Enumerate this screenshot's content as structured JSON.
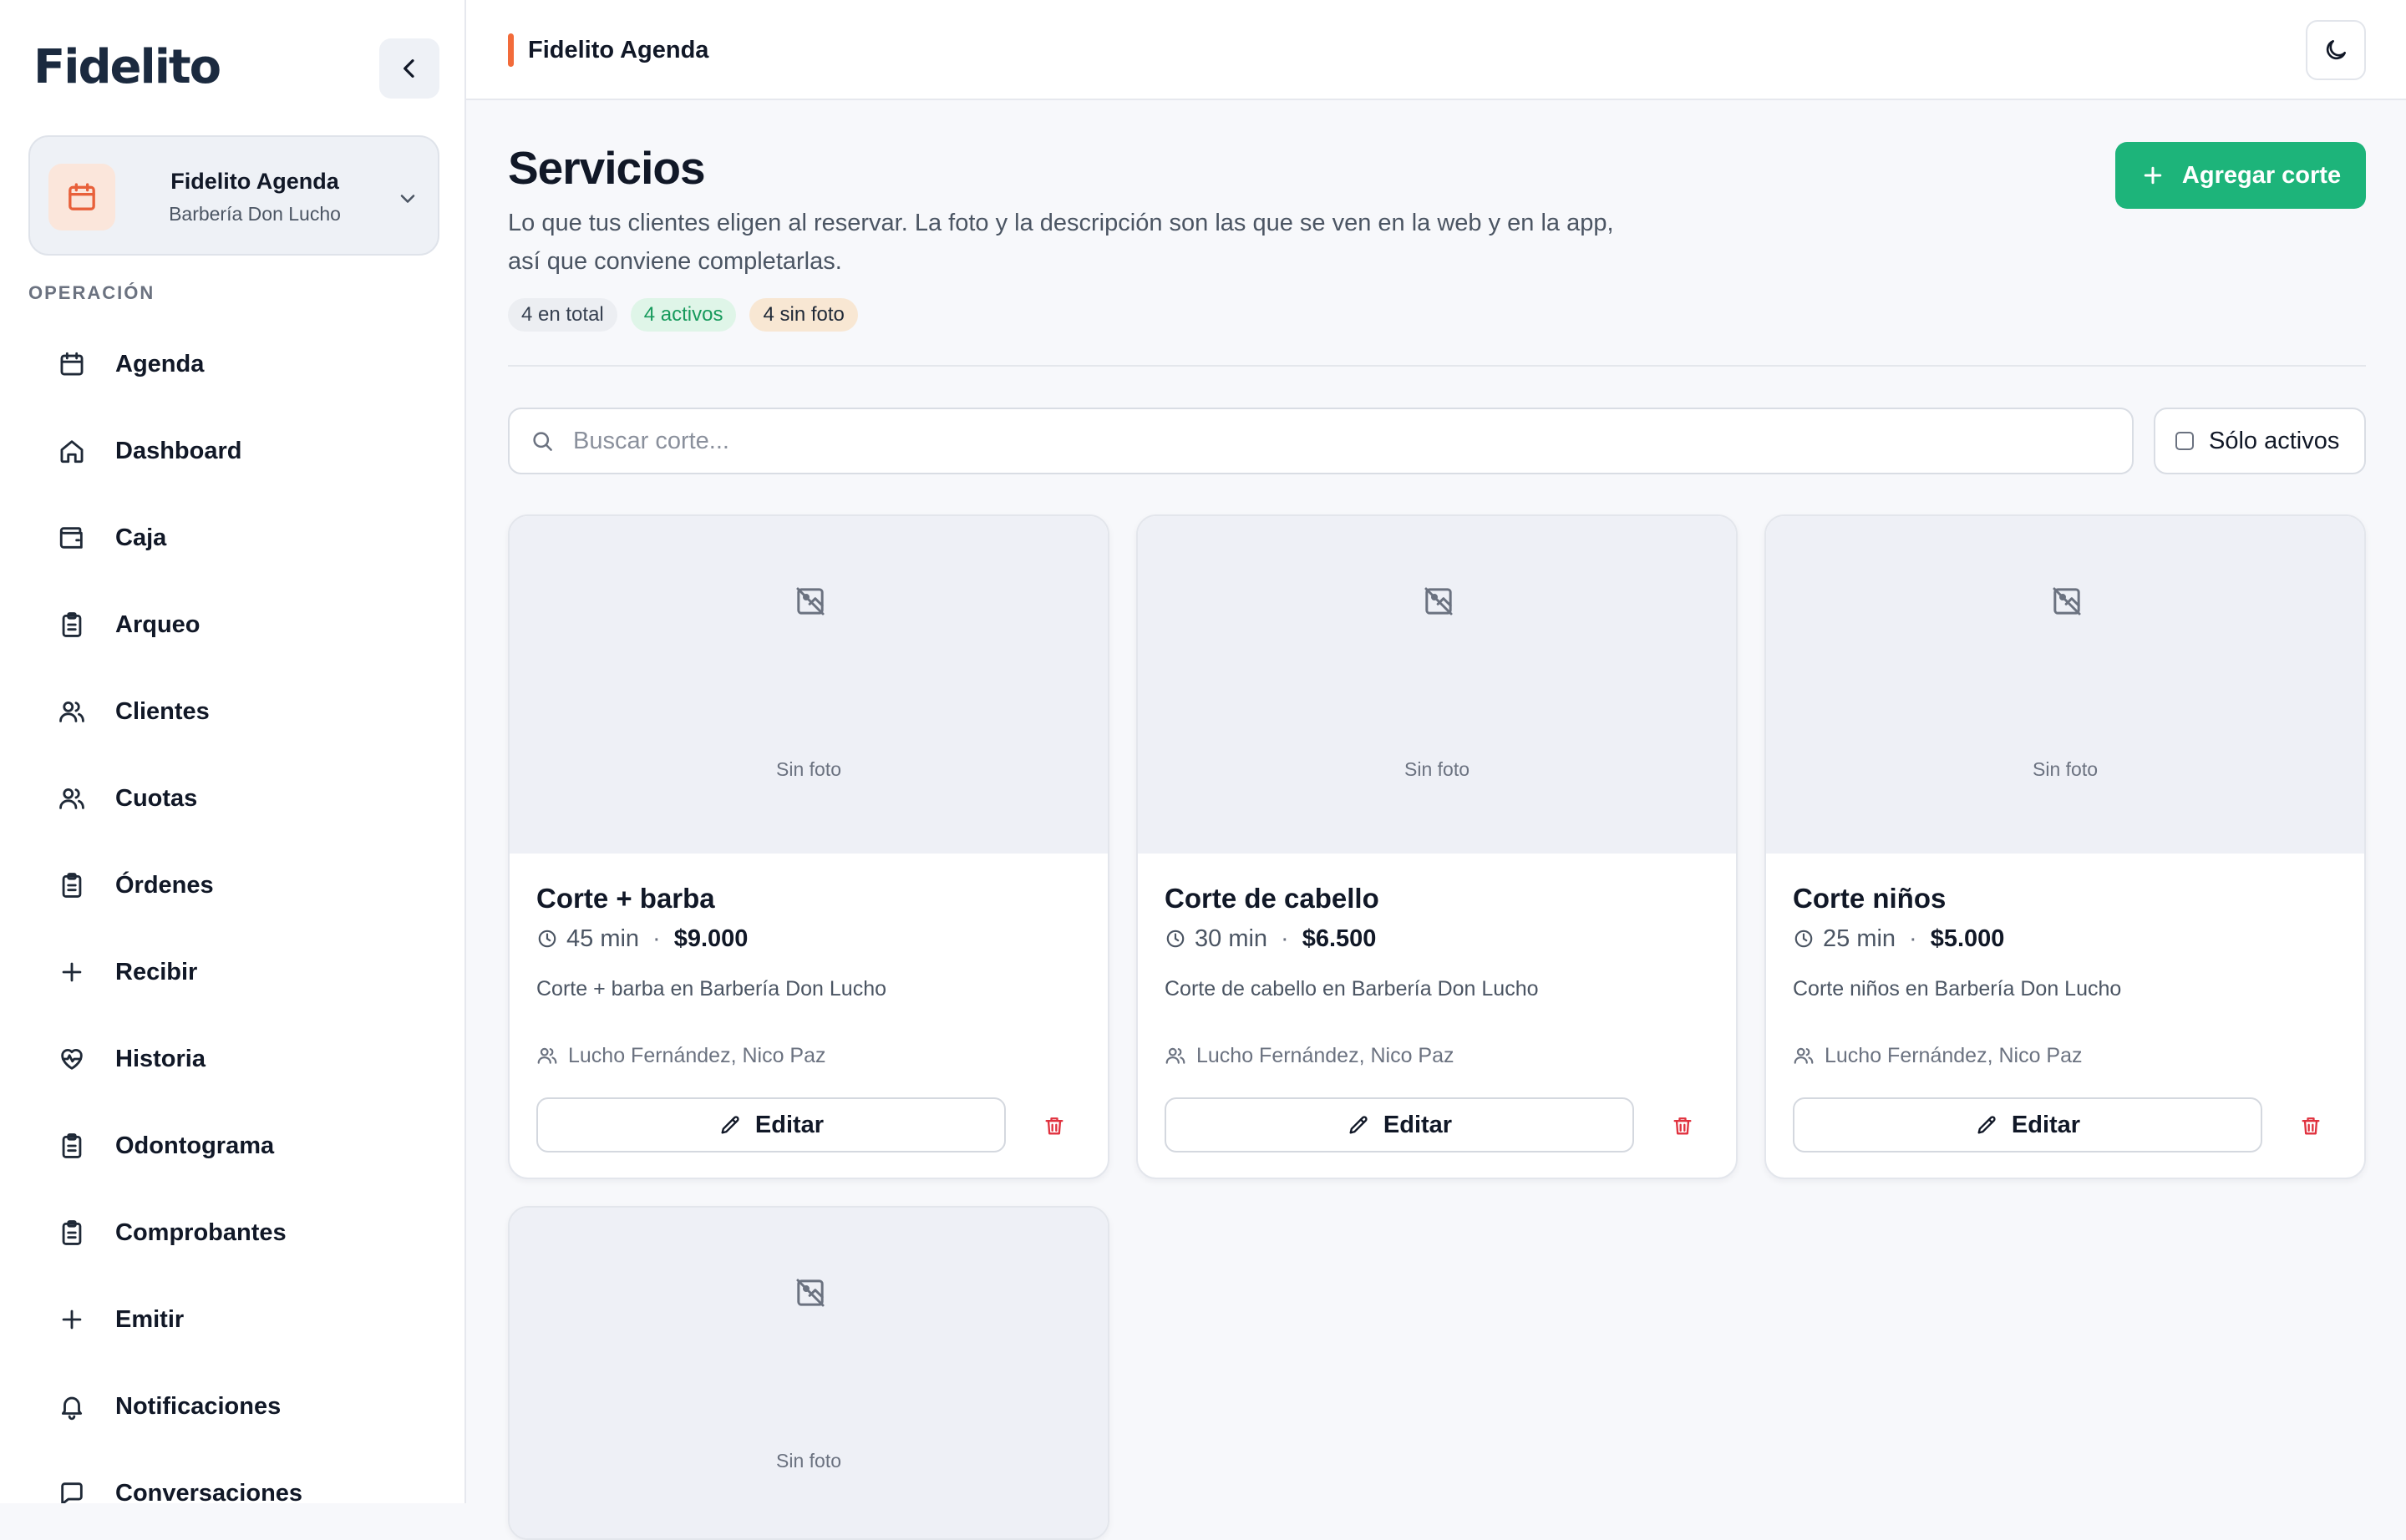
{
  "app": {
    "logo_text": "Fidelito",
    "accent_color": "#f26b3a",
    "primary_color": "#1db47a",
    "danger_color": "#e0313e"
  },
  "sidebar": {
    "org": {
      "name": "Fidelito Agenda",
      "subtitle": "Barbería Don Lucho",
      "icon": "calendar-icon"
    },
    "section_label": "OPERACIÓN",
    "items": [
      {
        "label": "Agenda",
        "icon": "calendar-icon"
      },
      {
        "label": "Dashboard",
        "icon": "home-icon"
      },
      {
        "label": "Caja",
        "icon": "wallet-icon"
      },
      {
        "label": "Arqueo",
        "icon": "clipboard-icon"
      },
      {
        "label": "Clientes",
        "icon": "users-icon"
      },
      {
        "label": "Cuotas",
        "icon": "users-icon"
      },
      {
        "label": "Órdenes",
        "icon": "clipboard-icon"
      },
      {
        "label": "Recibir",
        "icon": "plus-icon"
      },
      {
        "label": "Historia",
        "icon": "heart-pulse-icon"
      },
      {
        "label": "Odontograma",
        "icon": "clipboard-icon"
      },
      {
        "label": "Comprobantes",
        "icon": "clipboard-icon"
      },
      {
        "label": "Emitir",
        "icon": "plus-icon"
      },
      {
        "label": "Notificaciones",
        "icon": "bell-icon"
      },
      {
        "label": "Conversaciones",
        "icon": "chat-icon"
      }
    ]
  },
  "topbar": {
    "title": "Fidelito Agenda",
    "theme_icon": "moon-icon"
  },
  "page": {
    "title": "Servicios",
    "description": "Lo que tus clientes eligen al reservar. La foto y la descripción son las que se ven en la web y en la app, así que conviene completarlas.",
    "add_button": "Agregar corte",
    "badges": {
      "total": "4 en total",
      "active": "4 activos",
      "no_photo": "4 sin foto"
    },
    "search": {
      "placeholder": "Buscar corte...",
      "value": ""
    },
    "filter": {
      "label": "Sólo activos",
      "checked": false
    }
  },
  "cards": [
    {
      "photo_text": "Sin foto",
      "name": "Corte + barba",
      "duration": "45 min",
      "price": "$9.000",
      "description": "Corte + barba en Barbería Don Lucho",
      "staff": "Lucho Fernández, Nico Paz",
      "edit_label": "Editar"
    },
    {
      "photo_text": "Sin foto",
      "name": "Corte de cabello",
      "duration": "30 min",
      "price": "$6.500",
      "description": "Corte de cabello en Barbería Don Lucho",
      "staff": "Lucho Fernández, Nico Paz",
      "edit_label": "Editar"
    },
    {
      "photo_text": "Sin foto",
      "name": "Corte niños",
      "duration": "25 min",
      "price": "$5.000",
      "description": "Corte niños en Barbería Don Lucho",
      "staff": "Lucho Fernández, Nico Paz",
      "edit_label": "Editar"
    },
    {
      "photo_text": "Sin foto",
      "name": "",
      "duration": "",
      "price": "",
      "description": "",
      "staff": "",
      "edit_label": ""
    }
  ]
}
